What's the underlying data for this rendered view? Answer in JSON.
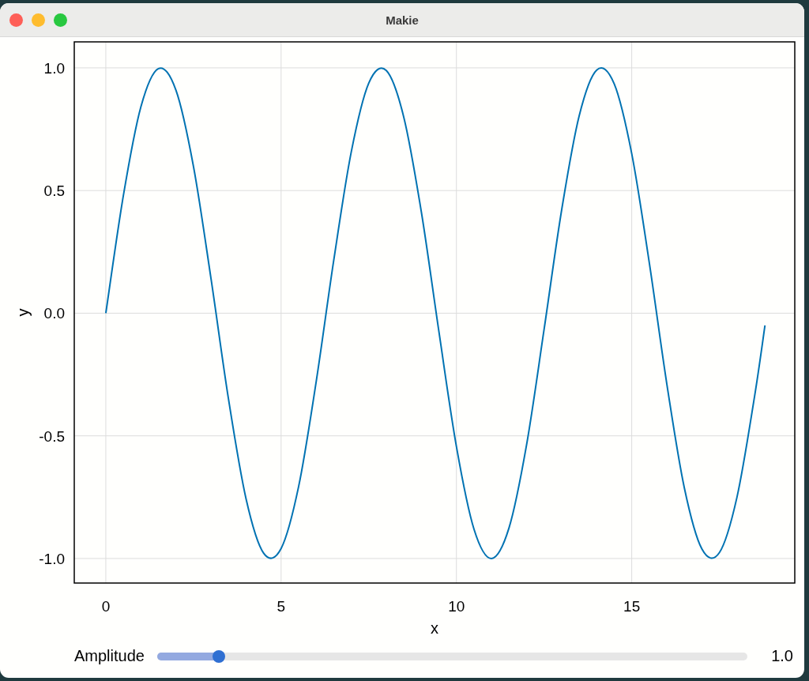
{
  "window": {
    "title": "Makie"
  },
  "plot": {
    "chart_data": {
      "type": "line",
      "grid": true,
      "xlabel": "x",
      "ylabel": "y",
      "xlim": [
        -0.9,
        19.65
      ],
      "ylim": [
        -1.1,
        1.106
      ],
      "xticks": [
        0,
        5,
        10,
        15
      ],
      "yticks": [
        {
          "value": 1,
          "label": "1.0"
        },
        {
          "value": 0.5,
          "label": "0.5"
        },
        {
          "value": 0,
          "label": "0.0"
        },
        {
          "value": -0.5,
          "label": "-0.5"
        },
        {
          "value": -1,
          "label": "-1.0"
        }
      ],
      "x": [
        0,
        0.5,
        1,
        1.5,
        2,
        2.5,
        3,
        3.5,
        4,
        4.5,
        5,
        5.5,
        6,
        6.5,
        7,
        7.5,
        8,
        8.5,
        9,
        9.5,
        10,
        10.5,
        11,
        11.5,
        12,
        12.5,
        13,
        13.5,
        14,
        14.5,
        15,
        15.5,
        16,
        16.5,
        17,
        17.5,
        18,
        18.5,
        18.8
      ],
      "series": [
        {
          "color": "#0072b2",
          "values": [
            0,
            0.479,
            0.841,
            0.997,
            0.909,
            0.598,
            0.141,
            -0.351,
            -0.757,
            -0.978,
            -0.959,
            -0.706,
            -0.279,
            0.215,
            0.657,
            0.938,
            0.989,
            0.798,
            0.412,
            -0.075,
            -0.544,
            -0.88,
            -1.0,
            -0.875,
            -0.537,
            -0.066,
            0.42,
            0.804,
            0.991,
            0.935,
            0.65,
            0.206,
            -0.288,
            -0.712,
            -0.961,
            -0.976,
            -0.751,
            -0.342,
            -0.05
          ]
        }
      ]
    }
  },
  "slider": {
    "label": "Amplitude",
    "level": 0.104,
    "reading": "1.0"
  }
}
